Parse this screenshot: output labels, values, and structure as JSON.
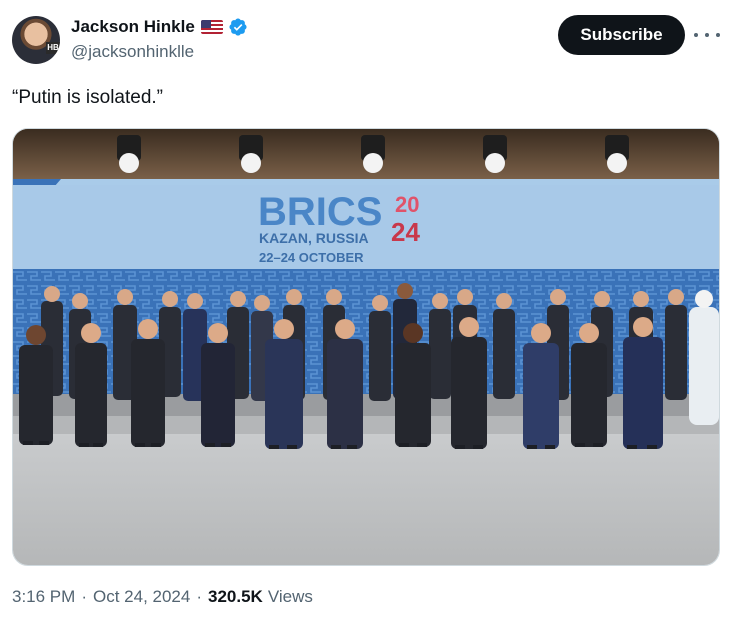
{
  "author": {
    "display_name": "Jackson Hinkle",
    "handle": "@jacksonhinklle",
    "avatar_badge": "HB",
    "flag_icon": "us-flag-icon",
    "verified_icon": "verified-badge-icon",
    "verified_color": "#1d9bf0"
  },
  "actions": {
    "subscribe_label": "Subscribe",
    "more_icon": "more-horizontal-icon"
  },
  "tweet": {
    "text": "“Putin is isolated.”"
  },
  "photo": {
    "banner_logo_text": "BRICS",
    "banner_year_top": "20",
    "banner_year_bottom": "24",
    "banner_location": "KAZAN, RUSSIA",
    "banner_dates": "22–24 OCTOBER",
    "accent_color": "#c8384b",
    "banner_blue": "#4a86c7"
  },
  "meta": {
    "time": "3:16 PM",
    "date": "Oct 24, 2024",
    "views_count": "320.5K",
    "views_label": "Views",
    "separator": "·"
  }
}
